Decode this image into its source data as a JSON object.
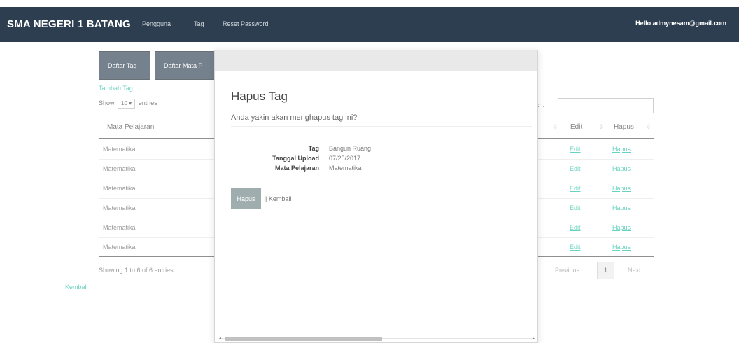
{
  "navbar": {
    "brand": "SMA NEGERI 1 BATANG",
    "links": [
      "Pengguna",
      "Tag",
      "Reset Password"
    ],
    "greeting": "Hello admynesam@gmail.com"
  },
  "tabs": [
    "Daftar Tag",
    "Daftar Mata P"
  ],
  "add_link": "Tambah Tag",
  "table_controls": {
    "show_label": "Show",
    "entries_value": "10",
    "entries_label": "entries",
    "search_label": "rch:"
  },
  "table": {
    "headers": [
      "Mata Pelajaran",
      "Edit",
      "Hapus"
    ],
    "rows": [
      {
        "mata_pelajaran": "Matematika",
        "edit": "Edit",
        "hapus": "Hapus"
      },
      {
        "mata_pelajaran": "Matematika",
        "edit": "Edit",
        "hapus": "Hapus"
      },
      {
        "mata_pelajaran": "Matematika",
        "edit": "Edit",
        "hapus": "Hapus"
      },
      {
        "mata_pelajaran": "Matematika",
        "edit": "Edit",
        "hapus": "Hapus"
      },
      {
        "mata_pelajaran": "Matematika",
        "edit": "Edit",
        "hapus": "Hapus"
      },
      {
        "mata_pelajaran": "Matematika",
        "edit": "Edit",
        "hapus": "Hapus"
      }
    ],
    "info": "Showing 1 to 6 of 6 entries",
    "pagination": {
      "previous": "Previous",
      "current": "1",
      "next": "Next"
    }
  },
  "back_link": "Kembali",
  "modal": {
    "title": "Hapus Tag",
    "question": "Anda yakin akan menghapus tag ini?",
    "details": [
      {
        "label": "Tag",
        "value": "Bangun Ruang"
      },
      {
        "label": "Tanggal Upload",
        "value": "07/25/2017"
      },
      {
        "label": "Mata Pelajaran",
        "value": "Matematika"
      }
    ],
    "delete_button": "Hapus",
    "separator": "|",
    "back_link": "Kembali"
  },
  "colors": {
    "navbar_bg": "#2c3e50",
    "link": "#18bc9c",
    "button_disabled": "#95a5a6"
  }
}
